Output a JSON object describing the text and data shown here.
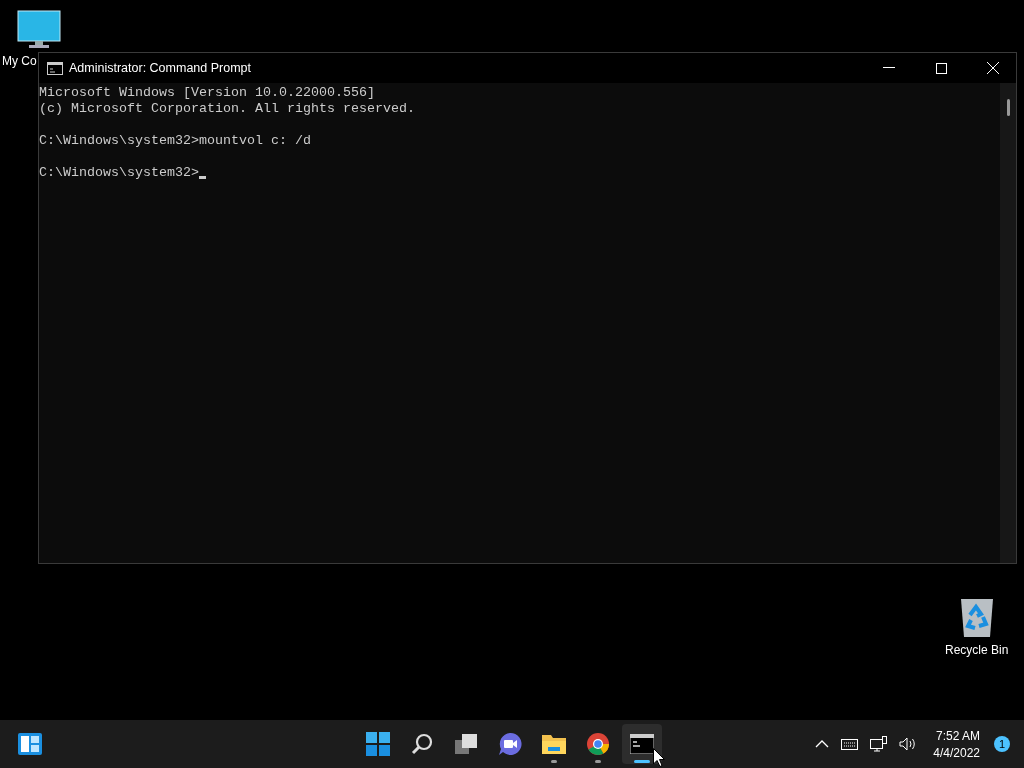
{
  "desktop_icons": [
    {
      "kind": "computer",
      "label": "My Co"
    },
    {
      "kind": "recycle",
      "label": "Recycle Bin"
    }
  ],
  "window": {
    "title": "Administrator: Command Prompt",
    "console_blocks": [
      [
        "Microsoft Windows [Version 10.0.22000.556]",
        "(c) Microsoft Corporation. All rights reserved."
      ],
      [
        "C:\\Windows\\system32>mountvol c: /d"
      ],
      [
        "C:\\Windows\\system32>"
      ]
    ]
  },
  "taskbar": {
    "apps": [
      {
        "kind": "start",
        "running": false,
        "active": false
      },
      {
        "kind": "search",
        "running": false,
        "active": false
      },
      {
        "kind": "taskview",
        "running": false,
        "active": false
      },
      {
        "kind": "chat",
        "running": false,
        "active": false
      },
      {
        "kind": "explorer",
        "running": true,
        "active": false
      },
      {
        "kind": "chrome",
        "running": true,
        "active": false
      },
      {
        "kind": "terminal",
        "running": true,
        "active": true
      }
    ],
    "time": "7:52 AM",
    "date": "4/4/2022",
    "notification_count": "1"
  }
}
